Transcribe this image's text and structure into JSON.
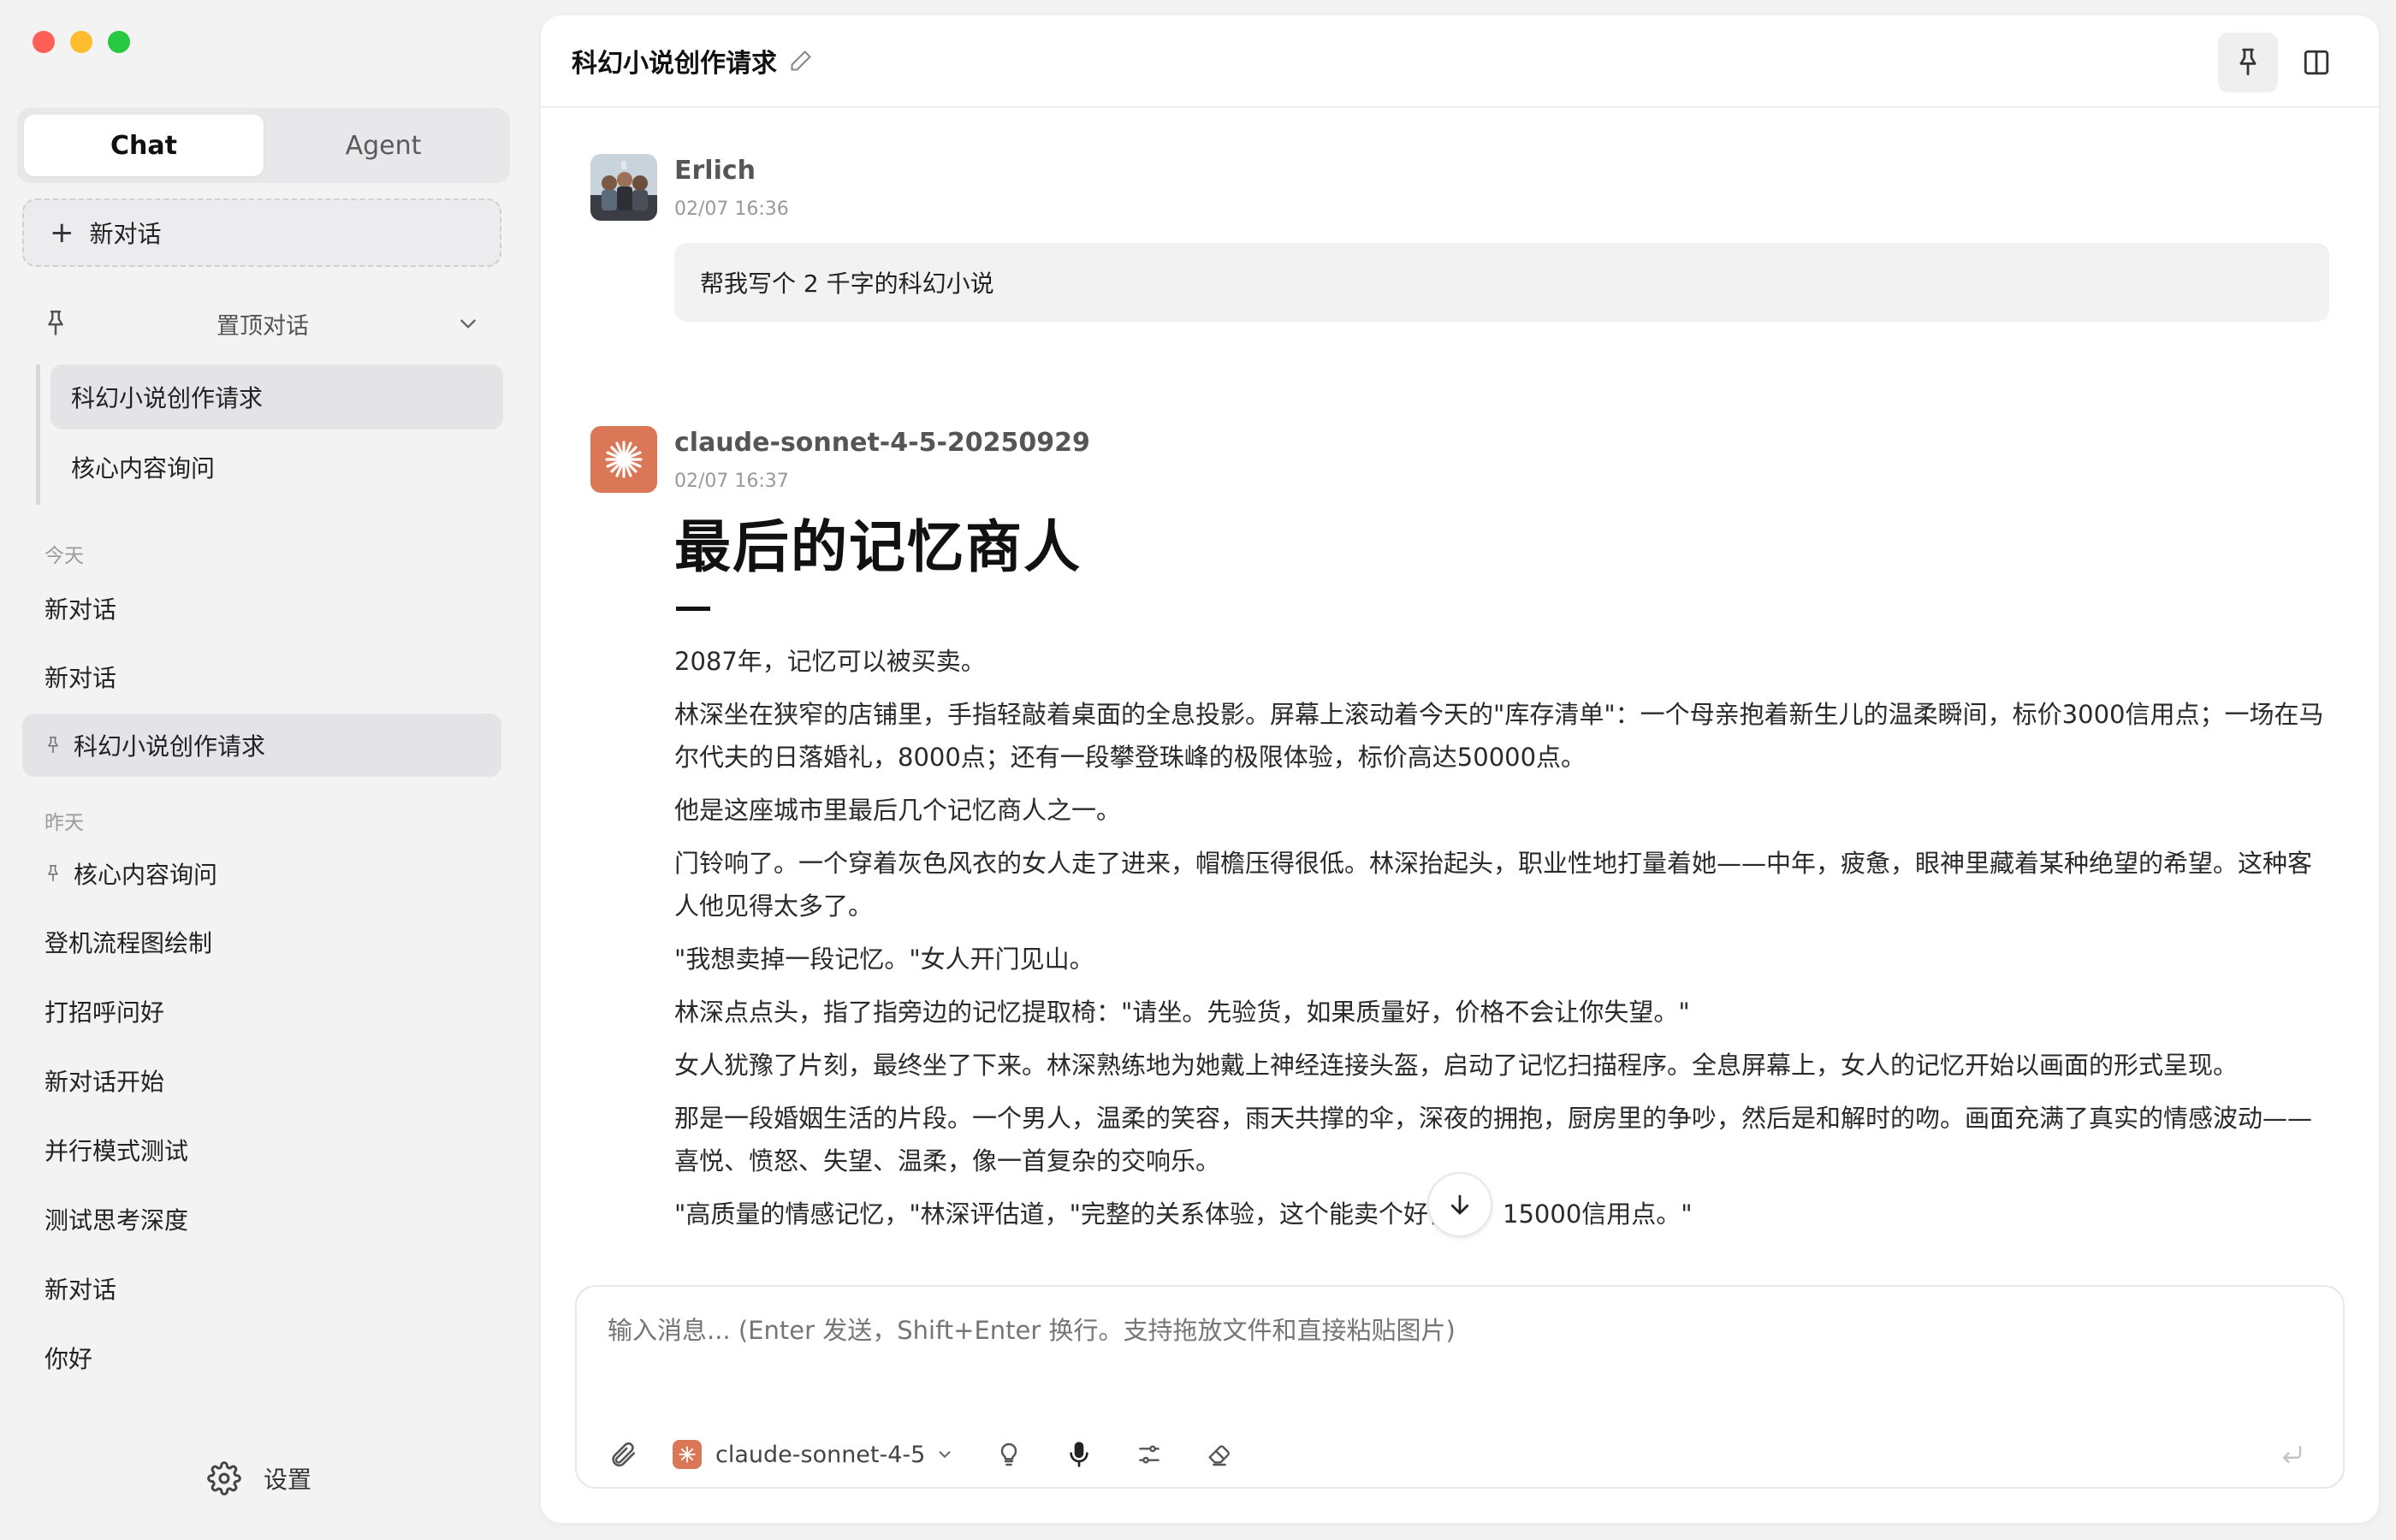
{
  "sidebar": {
    "tabs": [
      {
        "label": "Chat",
        "active": true
      },
      {
        "label": "Agent",
        "active": false
      }
    ],
    "new_chat_label": "新对话",
    "pinned_header": "置顶对话",
    "pinned_items": [
      {
        "label": "科幻小说创作请求",
        "active": true
      },
      {
        "label": "核心内容询问",
        "active": false
      }
    ],
    "today_label": "今天",
    "today_items": [
      {
        "label": "新对话"
      },
      {
        "label": "新对话"
      },
      {
        "label": "科幻小说创作请求",
        "pinned": true,
        "active": true
      }
    ],
    "yesterday_label": "昨天",
    "yesterday_items": [
      {
        "label": "核心内容询问",
        "pinned": true
      },
      {
        "label": "登机流程图绘制"
      },
      {
        "label": "打招呼问好"
      },
      {
        "label": "新对话开始"
      },
      {
        "label": "并行模式测试"
      },
      {
        "label": "测试思考深度"
      },
      {
        "label": "新对话"
      },
      {
        "label": "你好"
      }
    ],
    "settings_label": "设置"
  },
  "header": {
    "title": "科幻小说创作请求"
  },
  "messages": [
    {
      "role": "user",
      "name": "Erlich",
      "time": "02/07 16:36",
      "text": "帮我写个 2 千字的科幻小说"
    },
    {
      "role": "assistant",
      "name": "claude-sonnet-4-5-20250929",
      "time": "02/07 16:37",
      "heading": "最后的记忆商人",
      "paragraphs": [
        "2087年，记忆可以被买卖。",
        "林深坐在狭窄的店铺里，手指轻敲着桌面的全息投影。屏幕上滚动着今天的\"库存清单\"：一个母亲抱着新生儿的温柔瞬间，标价3000信用点；一场在马尔代夫的日落婚礼，8000点；还有一段攀登珠峰的极限体验，标价高达50000点。",
        "他是这座城市里最后几个记忆商人之一。",
        "门铃响了。一个穿着灰色风衣的女人走了进来，帽檐压得很低。林深抬起头，职业性地打量着她——中年，疲惫，眼神里藏着某种绝望的希望。这种客人他见得太多了。",
        "\"我想卖掉一段记忆。\"女人开门见山。",
        "林深点点头，指了指旁边的记忆提取椅：\"请坐。先验货，如果质量好，价格不会让你失望。\"",
        "女人犹豫了片刻，最终坐了下来。林深熟练地为她戴上神经连接头盔，启动了记忆扫描程序。全息屏幕上，女人的记忆开始以画面的形式呈现。",
        "那是一段婚姻生活的片段。一个男人，温柔的笑容，雨天共撑的伞，深夜的拥抱，厨房里的争吵，然后是和解时的吻。画面充满了真实的情感波动——喜悦、愤怒、失望、温柔，像一首复杂的交响乐。",
        "\"高质量的情感记忆，\"林深评估道，\"完整的关系体验，这个能卖个好价钱。15000信用点。\""
      ]
    }
  ],
  "composer": {
    "placeholder": "输入消息... (Enter 发送，Shift+Enter 换行。支持拖放文件和直接粘贴图片)",
    "model_label": "claude-sonnet-4-5"
  },
  "colors": {
    "claude_brand": "#d97757",
    "traffic_red": "#fe5f57",
    "traffic_yellow": "#febc2e",
    "traffic_green": "#28c840"
  }
}
